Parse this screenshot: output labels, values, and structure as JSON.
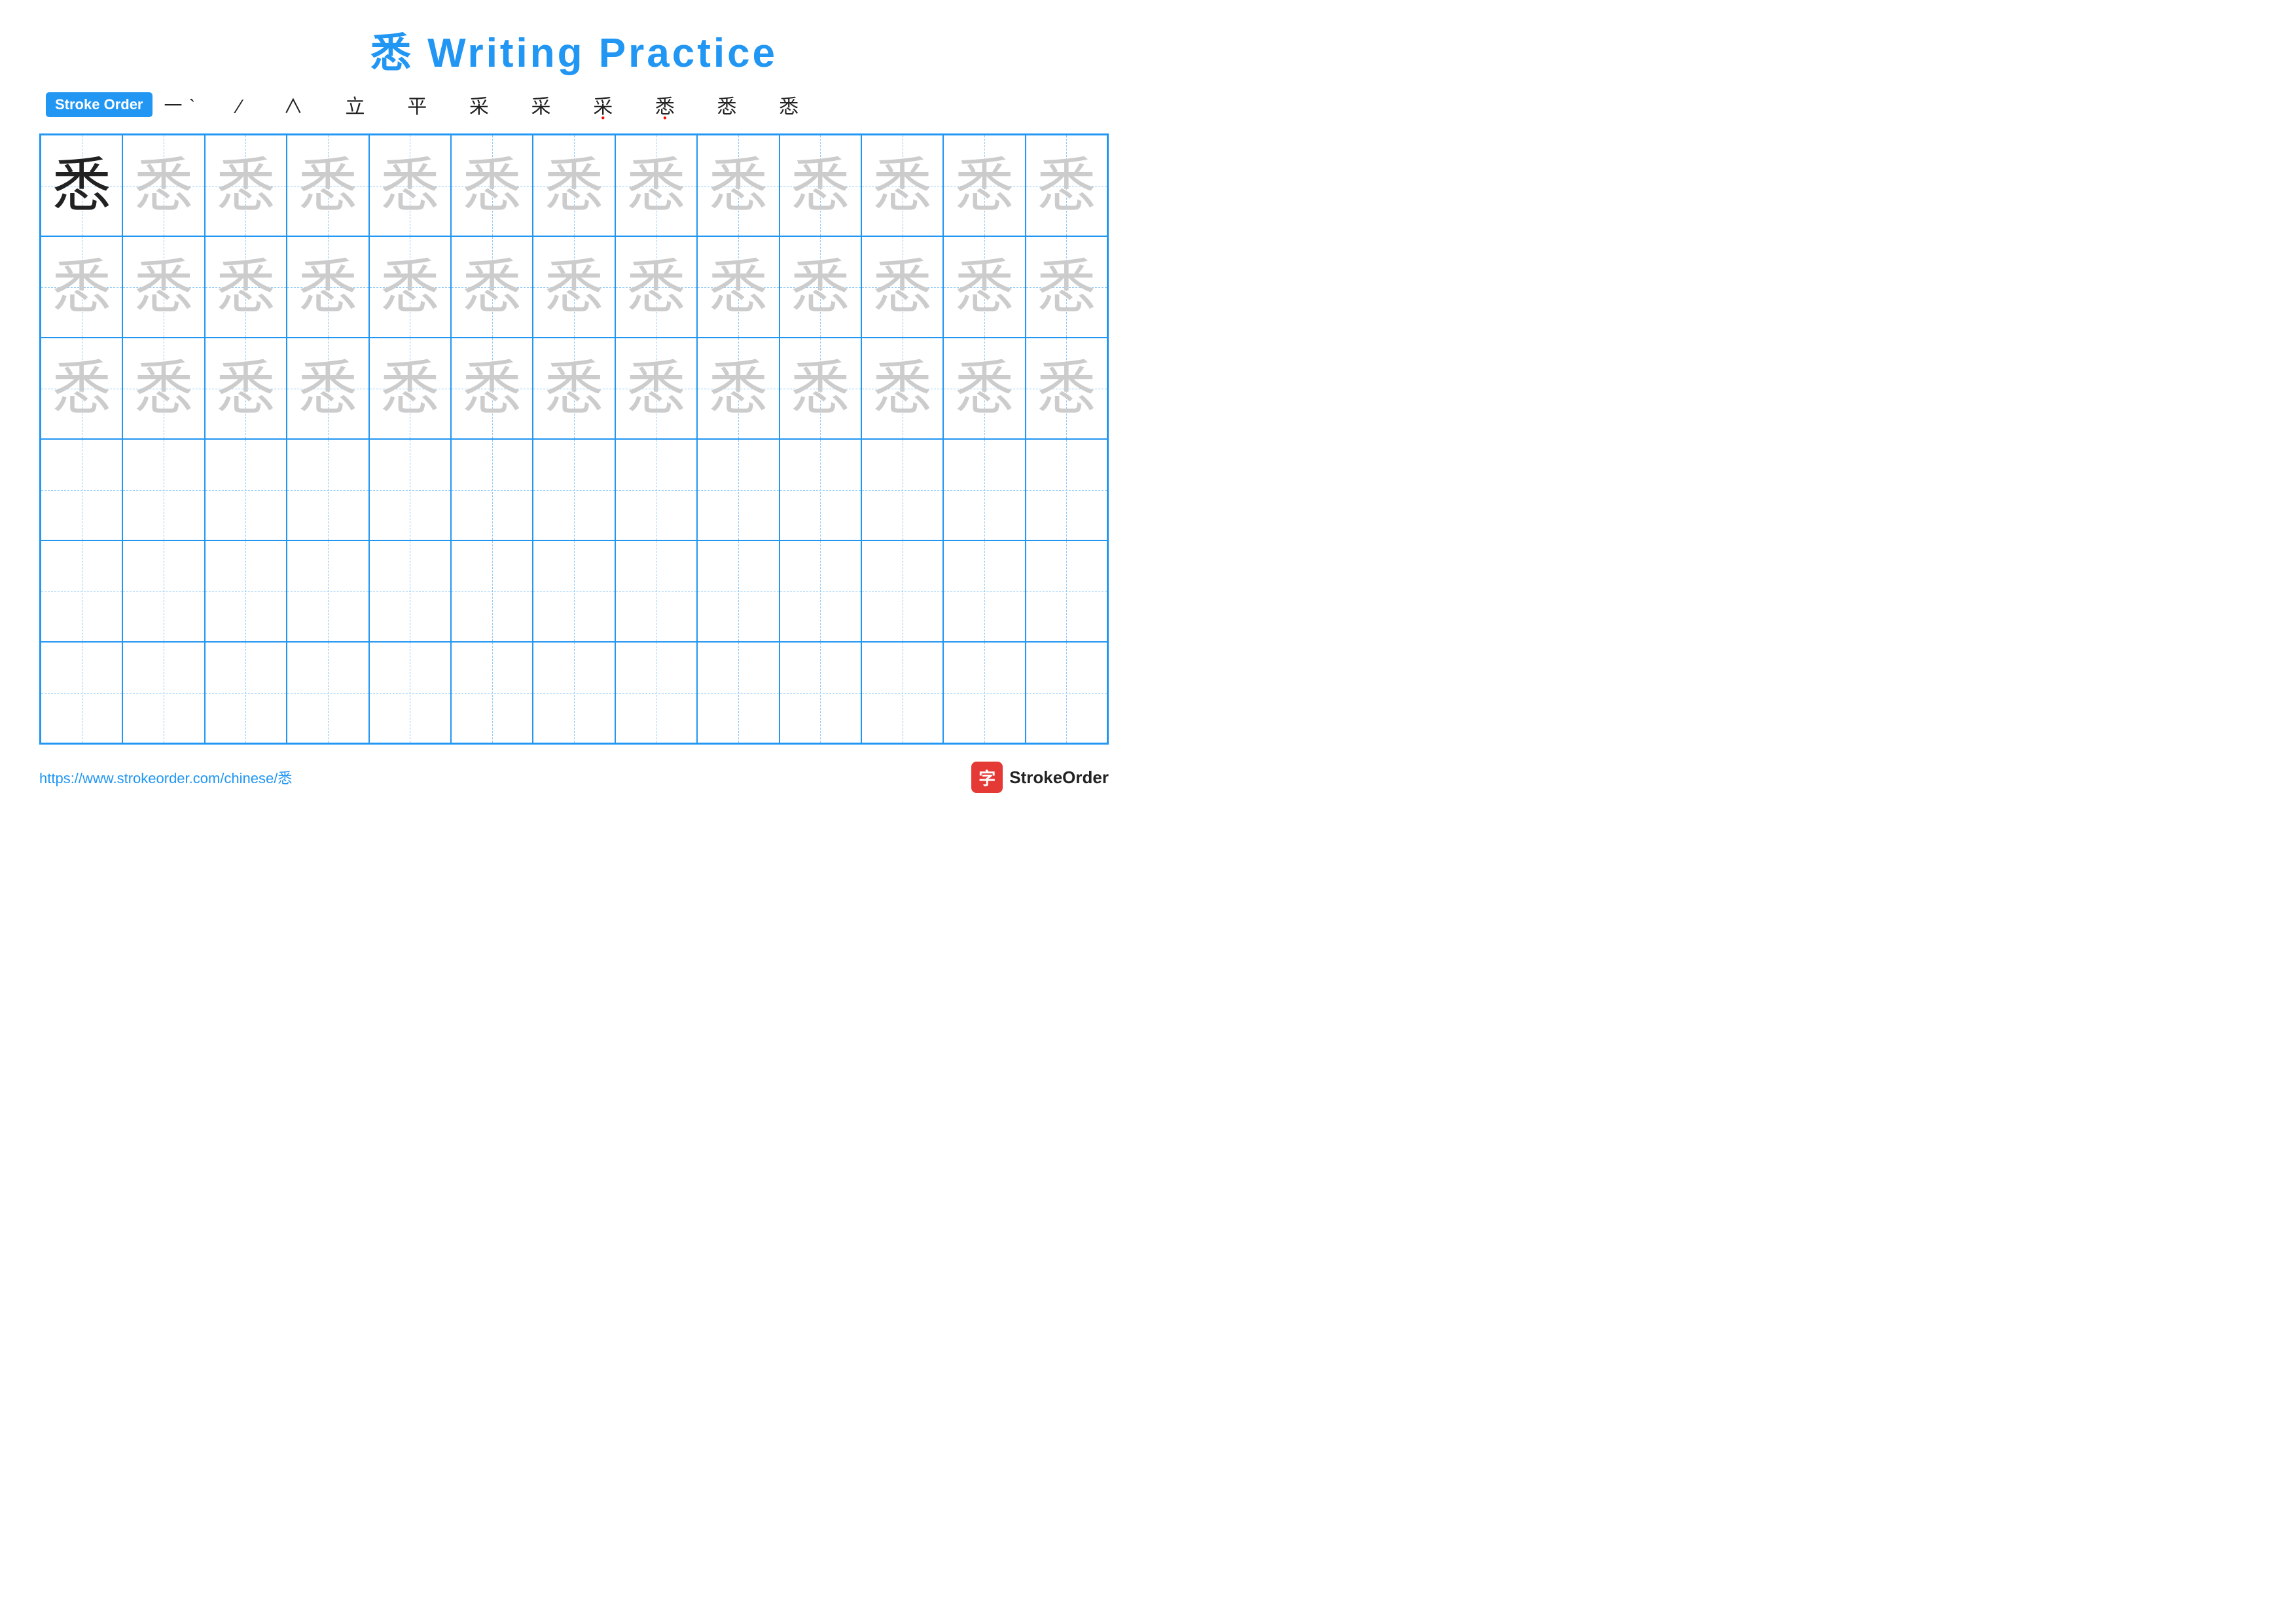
{
  "title": "悉 Writing Practice",
  "stroke_order": {
    "badge": "Stroke Order",
    "strokes": [
      "㇀",
      "㇁",
      "㇂",
      "立",
      "平",
      "采",
      "采",
      "采",
      "悉",
      "悉",
      "悉"
    ]
  },
  "grid": {
    "rows": 6,
    "cols": 13,
    "character": "悉",
    "filled_rows": 3,
    "first_cell_dark": true
  },
  "footer": {
    "url": "https://www.strokeorder.com/chinese/悉",
    "logo_text": "StrokeOrder",
    "logo_char": "字"
  }
}
